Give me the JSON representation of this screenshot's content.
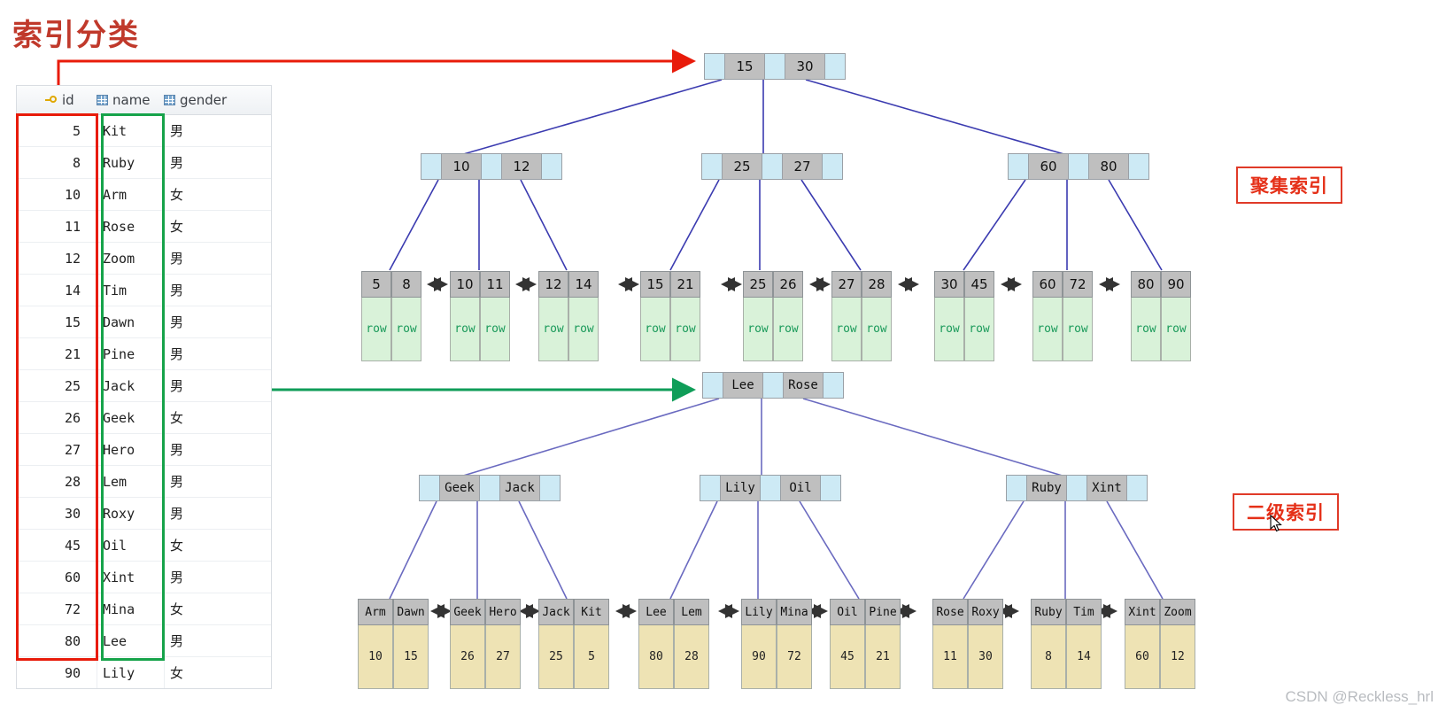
{
  "page": {
    "title": "索引分类",
    "watermark": "CSDN @Reckless_hrl"
  },
  "table": {
    "columns": [
      {
        "label": "id",
        "icon": "primary-key-icon"
      },
      {
        "label": "name",
        "icon": "column-icon"
      },
      {
        "label": "gender",
        "icon": "column-icon"
      }
    ],
    "rows": [
      {
        "id": "5",
        "name": "Kit",
        "gender": "男"
      },
      {
        "id": "8",
        "name": "Ruby",
        "gender": "男"
      },
      {
        "id": "10",
        "name": "Arm",
        "gender": "女"
      },
      {
        "id": "11",
        "name": "Rose",
        "gender": "女"
      },
      {
        "id": "12",
        "name": "Zoom",
        "gender": "男"
      },
      {
        "id": "14",
        "name": "Tim",
        "gender": "男"
      },
      {
        "id": "15",
        "name": "Dawn",
        "gender": "男"
      },
      {
        "id": "21",
        "name": "Pine",
        "gender": "男"
      },
      {
        "id": "25",
        "name": "Jack",
        "gender": "男"
      },
      {
        "id": "26",
        "name": "Geek",
        "gender": "女"
      },
      {
        "id": "27",
        "name": "Hero",
        "gender": "男"
      },
      {
        "id": "28",
        "name": "Lem",
        "gender": "男"
      },
      {
        "id": "30",
        "name": "Roxy",
        "gender": "男"
      },
      {
        "id": "45",
        "name": "Oil",
        "gender": "女"
      },
      {
        "id": "60",
        "name": "Xint",
        "gender": "男"
      },
      {
        "id": "72",
        "name": "Mina",
        "gender": "女"
      },
      {
        "id": "80",
        "name": "Lee",
        "gender": "男"
      },
      {
        "id": "90",
        "name": "Lily",
        "gender": "女"
      }
    ],
    "highlights": [
      {
        "name": "id-column-highlight",
        "color": "#e81b0a"
      },
      {
        "name": "name-column-highlight",
        "color": "#16a34a"
      }
    ]
  },
  "annotations": [
    {
      "name": "clustered-index-label",
      "text": "聚集索引",
      "color": "#e53018"
    },
    {
      "name": "secondary-index-label",
      "text": "二级索引",
      "color": "#e53018"
    }
  ],
  "arrows": [
    {
      "name": "id-to-clustered-arrow",
      "color": "#e81b0a"
    },
    {
      "name": "name-to-secondary-arrow",
      "color": "#0f9d58"
    }
  ],
  "clustered_index": {
    "root": {
      "keys": [
        "15",
        "30"
      ]
    },
    "internal": [
      {
        "keys": [
          "10",
          "12"
        ]
      },
      {
        "keys": [
          "25",
          "27"
        ]
      },
      {
        "keys": [
          "60",
          "80"
        ]
      }
    ],
    "leaves": [
      {
        "keys": [
          "5",
          "8"
        ],
        "values": [
          "row",
          "row"
        ]
      },
      {
        "keys": [
          "10",
          "11"
        ],
        "values": [
          "row",
          "row"
        ]
      },
      {
        "keys": [
          "12",
          "14"
        ],
        "values": [
          "row",
          "row"
        ]
      },
      {
        "keys": [
          "15",
          "21"
        ],
        "values": [
          "row",
          "row"
        ]
      },
      {
        "keys": [
          "25",
          "26"
        ],
        "values": [
          "row",
          "row"
        ]
      },
      {
        "keys": [
          "27",
          "28"
        ],
        "values": [
          "row",
          "row"
        ]
      },
      {
        "keys": [
          "30",
          "45"
        ],
        "values": [
          "row",
          "row"
        ]
      },
      {
        "keys": [
          "60",
          "72"
        ],
        "values": [
          "row",
          "row"
        ]
      },
      {
        "keys": [
          "80",
          "90"
        ],
        "values": [
          "row",
          "row"
        ]
      }
    ]
  },
  "secondary_index": {
    "root": {
      "keys": [
        "Lee",
        "Rose"
      ]
    },
    "internal": [
      {
        "keys": [
          "Geek",
          "Jack"
        ]
      },
      {
        "keys": [
          "Lily",
          "Oil"
        ]
      },
      {
        "keys": [
          "Ruby",
          "Xint"
        ]
      }
    ],
    "leaves": [
      {
        "keys": [
          "Arm",
          "Dawn"
        ],
        "values": [
          "10",
          "15"
        ]
      },
      {
        "keys": [
          "Geek",
          "Hero"
        ],
        "values": [
          "26",
          "27"
        ]
      },
      {
        "keys": [
          "Jack",
          "Kit"
        ],
        "values": [
          "25",
          "5"
        ]
      },
      {
        "keys": [
          "Lee",
          "Lem"
        ],
        "values": [
          "80",
          "28"
        ]
      },
      {
        "keys": [
          "Lily",
          "Mina"
        ],
        "values": [
          "90",
          "72"
        ]
      },
      {
        "keys": [
          "Oil",
          "Pine"
        ],
        "values": [
          "45",
          "21"
        ]
      },
      {
        "keys": [
          "Rose",
          "Roxy"
        ],
        "values": [
          "11",
          "30"
        ]
      },
      {
        "keys": [
          "Ruby",
          "Tim"
        ],
        "values": [
          "8",
          "14"
        ]
      },
      {
        "keys": [
          "Xint",
          "Zoom"
        ],
        "values": [
          "60",
          "12"
        ]
      }
    ]
  },
  "colors": {
    "pointer_cell": "#cdeaf5",
    "key_cell": "#bfbfbf",
    "clustered_leaf_value": "#d9f2d9",
    "secondary_leaf_value": "#eee3b4",
    "edge": "#3b3bb0",
    "title": "#c0392b"
  }
}
